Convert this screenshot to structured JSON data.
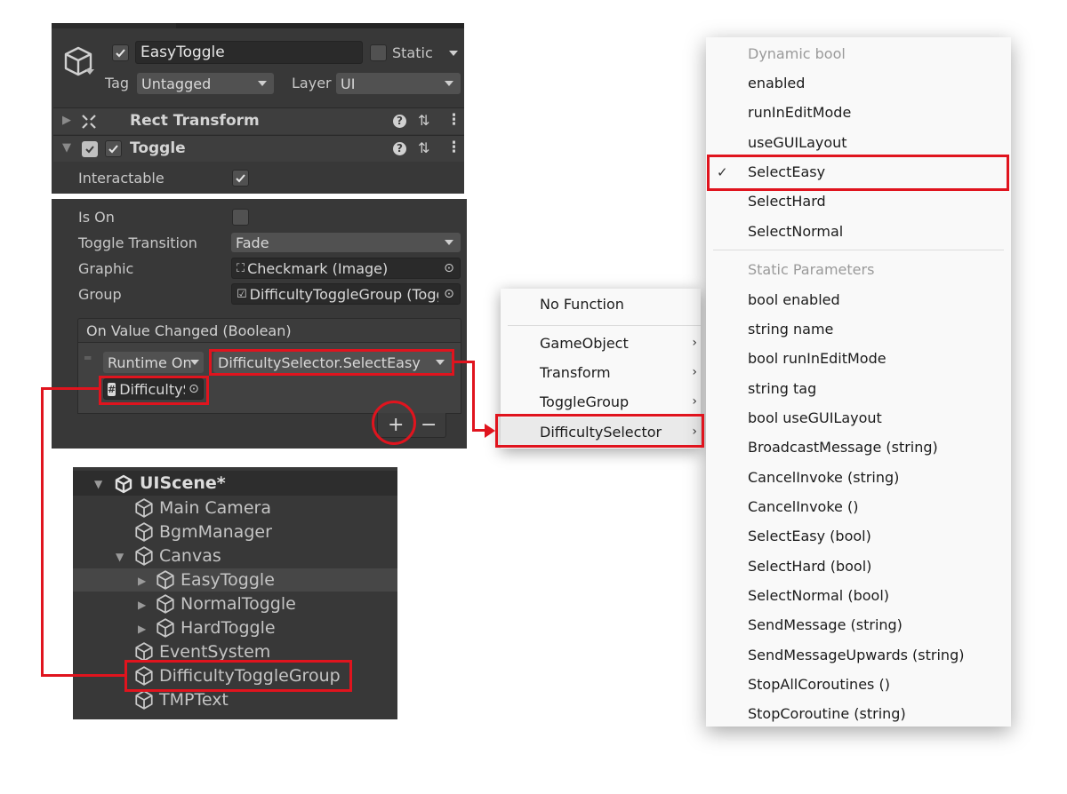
{
  "inspector": {
    "object_name": "EasyToggle",
    "static_label": "Static",
    "tag_label": "Tag",
    "tag_value": "Untagged",
    "layer_label": "Layer",
    "layer_value": "UI",
    "rect_transform_title": "Rect Transform",
    "toggle_title": "Toggle",
    "interactable_label": "Interactable",
    "is_on_label": "Is On",
    "toggle_transition_label": "Toggle Transition",
    "toggle_transition_value": "Fade",
    "graphic_label": "Graphic",
    "graphic_value": "Checkmark (Image)",
    "group_label": "Group",
    "group_value": "DifficultyToggleGroup (Toggle Group)",
    "event_title": "On Value Changed (Boolean)",
    "runtime_value": "Runtime On",
    "function_value": "DifficultySelector.SelectEasy",
    "target_value": "DifficultySelector",
    "plus_label": "+",
    "minus_label": "−"
  },
  "hierarchy": {
    "scene": "UIScene*",
    "items": [
      {
        "label": "Main Camera"
      },
      {
        "label": "BgmManager"
      },
      {
        "label": "Canvas"
      },
      {
        "label": "EasyToggle"
      },
      {
        "label": "NormalToggle"
      },
      {
        "label": "HardToggle"
      },
      {
        "label": "EventSystem"
      },
      {
        "label": "DifficultyToggleGroup"
      },
      {
        "label": "TMPText"
      }
    ]
  },
  "context_menu": {
    "items": [
      {
        "label": "No Function"
      },
      {
        "label": "GameObject"
      },
      {
        "label": "Transform"
      },
      {
        "label": "ToggleGroup"
      },
      {
        "label": "DifficultySelector"
      }
    ],
    "arrow": "›"
  },
  "function_menu": {
    "header_dynamic": "Dynamic bool",
    "dynamic": [
      "enabled",
      "runInEditMode",
      "useGUILayout",
      "SelectEasy",
      "SelectHard",
      "SelectNormal"
    ],
    "checkmark": "✓",
    "header_static": "Static Parameters",
    "static": [
      "bool enabled",
      "string name",
      "bool runInEditMode",
      "string tag",
      "bool useGUILayout",
      "BroadcastMessage (string)",
      "CancelInvoke (string)",
      "CancelInvoke ()",
      "SelectEasy (bool)",
      "SelectHard (bool)",
      "SelectNormal (bool)",
      "SendMessage (string)",
      "SendMessageUpwards (string)",
      "StopAllCoroutines ()",
      "StopCoroutine (string)"
    ]
  },
  "colors": {
    "panel": "#383838",
    "highlight_red": "#e0141e",
    "menu_bg": "#f9f9f9"
  }
}
